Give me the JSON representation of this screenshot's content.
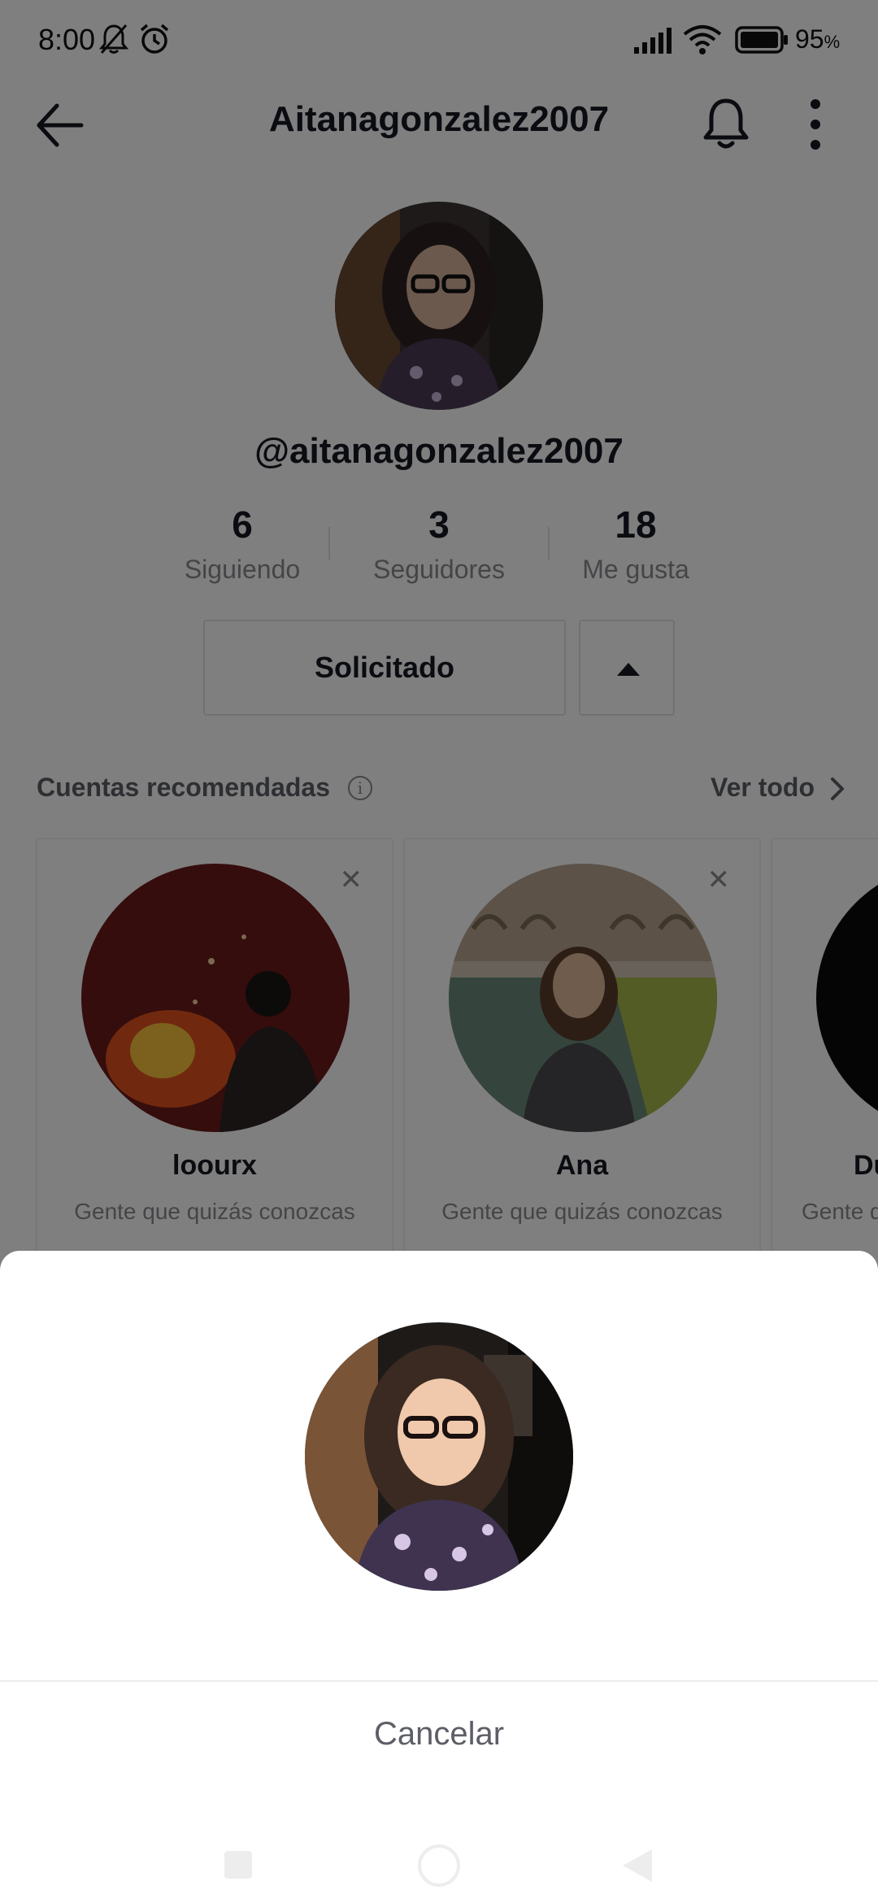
{
  "status_bar": {
    "time": "8:00",
    "battery_percent": "95",
    "battery_unit": "%",
    "icons": [
      "mute-bell-icon",
      "alarm-icon",
      "signal-icon",
      "wifi-icon",
      "battery-icon"
    ]
  },
  "header": {
    "title": "Aitanagonzalez2007",
    "icons": [
      "back-arrow-icon",
      "bell-icon",
      "more-vertical-icon"
    ]
  },
  "profile": {
    "handle": "@aitanagonzalez2007",
    "stats": [
      {
        "value": "6",
        "label": "Siguiendo"
      },
      {
        "value": "3",
        "label": "Seguidores"
      },
      {
        "value": "18",
        "label": "Me gusta"
      }
    ],
    "follow_button_label": "Solicitado"
  },
  "recommended": {
    "title": "Cuentas recomendadas",
    "see_all_label": "Ver todo",
    "cards": [
      {
        "name": "loourx",
        "subtitle": "Gente que quizás conozcas"
      },
      {
        "name": "Ana",
        "subtitle": "Gente que quizás conozcas"
      },
      {
        "name": "Du",
        "subtitle": "Gente que quizás conozcas"
      }
    ]
  },
  "sheet": {
    "cancel_label": "Cancelar"
  },
  "colors": {
    "text_primary": "#161823",
    "text_secondary": "#8a8b91",
    "overlay": "rgba(0,0,0,0.5)",
    "sheet_bg": "#ffffff"
  }
}
